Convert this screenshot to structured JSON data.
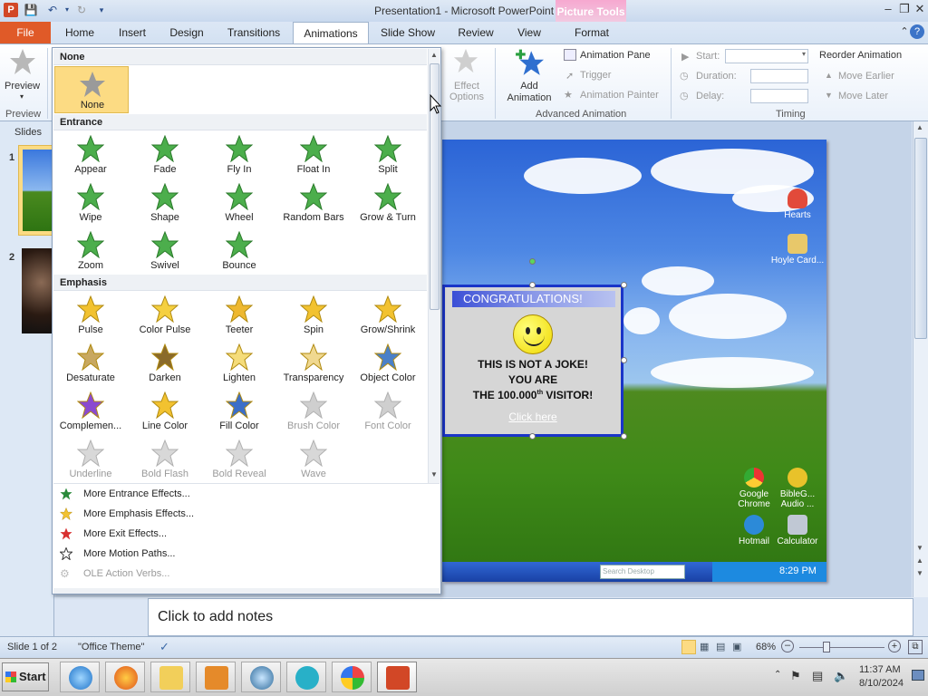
{
  "window": {
    "title": "Presentation1 - Microsoft PowerPoint",
    "context_tools": "Picture Tools",
    "context_tab": "Format"
  },
  "tabs": [
    "File",
    "Home",
    "Insert",
    "Design",
    "Transitions",
    "Animations",
    "Slide Show",
    "Review",
    "View"
  ],
  "ribbon": {
    "preview": {
      "label": "Preview",
      "group": "Preview"
    },
    "effect_options": "Effect Options",
    "add_animation": "Add Animation",
    "animation_pane": "Animation Pane",
    "trigger": "Trigger",
    "animation_painter": "Animation Painter",
    "advanced_group": "Advanced Animation",
    "start_label": "Start:",
    "duration_label": "Duration:",
    "delay_label": "Delay:",
    "reorder_label": "Reorder Animation",
    "move_earlier": "Move Earlier",
    "move_later": "Move Later",
    "timing_group": "Timing"
  },
  "left_pane": {
    "header": "Slides",
    "slide1": "1",
    "slide2": "2"
  },
  "gallery": {
    "none_header": "None",
    "none_item": "None",
    "entrance_header": "Entrance",
    "emphasis_header": "Emphasis",
    "entrance": [
      "Appear",
      "Fade",
      "Fly In",
      "Float In",
      "Split",
      "Wipe",
      "Shape",
      "Wheel",
      "Random Bars",
      "Grow & Turn",
      "Zoom",
      "Swivel",
      "Bounce"
    ],
    "emphasis": [
      "Pulse",
      "Color Pulse",
      "Teeter",
      "Spin",
      "Grow/Shrink",
      "Desaturate",
      "Darken",
      "Lighten",
      "Transparency",
      "Object Color",
      "Complemen...",
      "Line Color",
      "Fill Color",
      "Brush Color",
      "Font Color",
      "Underline",
      "Bold Flash",
      "Bold Reveal",
      "Wave"
    ],
    "more": [
      "More Entrance Effects...",
      "More Emphasis Effects...",
      "More Exit Effects...",
      "More Motion Paths...",
      "OLE Action Verbs..."
    ]
  },
  "slide": {
    "popup_title": "CONGRATULATIONS!",
    "line1": "THIS IS NOT A JOKE!",
    "line2": "YOU ARE",
    "line3_pre": "THE 100.000",
    "line3_sup": "th",
    "line3_post": " VISITOR!",
    "link": "Click here",
    "desktop_icons": [
      "Hearts",
      "Hoyle Card...",
      "Google Chrome",
      "BibleG... Audio ...",
      "Hotmail",
      "Calculator"
    ],
    "xp_search": "Search Desktop",
    "xp_clock": "8:29 PM"
  },
  "notes_placeholder": "Click to add notes",
  "status": {
    "slide": "Slide 1 of 2",
    "theme": "\"Office Theme\"",
    "zoom": "68%"
  },
  "taskbar": {
    "start": "Start",
    "time": "11:37 AM",
    "date": "8/10/2024"
  }
}
